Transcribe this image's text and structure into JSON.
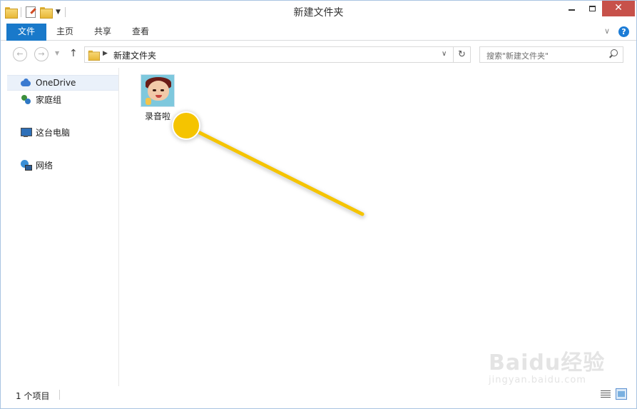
{
  "window": {
    "title": "新建文件夹"
  },
  "quick_access": {
    "icons": [
      "folder-icon",
      "properties-icon",
      "new-folder-icon",
      "customize-qat-icon"
    ]
  },
  "ribbon": {
    "tabs": [
      {
        "label": "文件",
        "active": true
      },
      {
        "label": "主页"
      },
      {
        "label": "共享"
      },
      {
        "label": "查看"
      }
    ],
    "help": "?"
  },
  "navigation": {
    "back": "←",
    "forward": "→",
    "up": "↑",
    "address": {
      "crumb": "新建文件夹"
    },
    "refresh": "↻",
    "search": {
      "placeholder": "搜索\"新建文件夹\""
    }
  },
  "sidebar": {
    "items": [
      {
        "label": "OneDrive",
        "icon": "onedrive-icon",
        "selected": true
      },
      {
        "label": "家庭组",
        "icon": "homegroup-icon"
      },
      {
        "label": "这台电脑",
        "icon": "this-pc-icon"
      },
      {
        "label": "网络",
        "icon": "network-icon"
      }
    ]
  },
  "files": [
    {
      "name": "录音啦",
      "icon": "app-cartoon-icon"
    }
  ],
  "status": {
    "item_count": "1 个项目"
  },
  "watermark": {
    "main": "Baidu经验",
    "sub": "jingyan.baidu.com"
  },
  "colors": {
    "file_tab": "#1979ca",
    "close_button": "#c7514a",
    "annotation": "#f5c400",
    "selected_nav": "#eaf1fa"
  }
}
